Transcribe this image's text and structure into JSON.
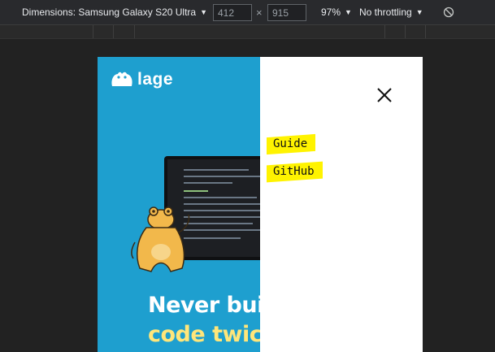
{
  "devtools": {
    "device_label": "Dimensions: Samsung Galaxy S20 Ultra",
    "width_value": "412",
    "height_value": "915",
    "times_glyph": "×",
    "zoom_label": "97%",
    "throttle_label": "No throttling",
    "icons": {
      "dropdown": "caret-down-icon",
      "rotate": "rotate-icon"
    }
  },
  "site": {
    "logo_text": "lage",
    "hero_line1": "Never build",
    "hero_line2": "code twice",
    "nav": [
      {
        "label": "Guide"
      },
      {
        "label": "GitHub"
      }
    ],
    "close_icon": "close-icon",
    "colors": {
      "hero_bg": "#1e9fcf",
      "highlight": "#fff300",
      "accent_text": "#ffe67a"
    }
  }
}
